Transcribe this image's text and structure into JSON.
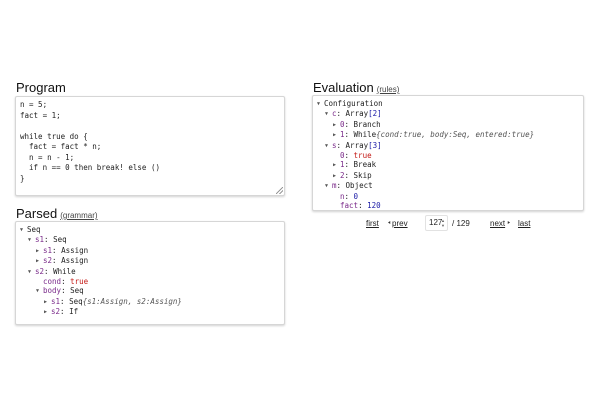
{
  "program": {
    "title": "Program",
    "code": "n = 5;\nfact = 1;\n\nwhile true do {\n  fact = fact * n;\n  n = n - 1;\n  if n == 0 then break! else ()\n}"
  },
  "parsed": {
    "title": "Parsed",
    "grammar_link": "(grammar)",
    "tree": {
      "root": "Seq",
      "s1_key": "s1",
      "s1_type": "Seq",
      "s1_s1_key": "s1",
      "s1_s1_type": "Assign",
      "s1_s2_key": "s2",
      "s1_s2_type": "Assign",
      "s2_key": "s2",
      "s2_type": "While",
      "cond_key": "cond",
      "cond_value": "true",
      "body_key": "body",
      "body_type": "Seq",
      "body_s1_key": "s1",
      "body_s1_type": "Seq",
      "body_s1_note": "{s1:Assign, s2:Assign}",
      "body_s2_key": "s2",
      "body_s2_type": "If"
    }
  },
  "evaluation": {
    "title": "Evaluation",
    "rules_link": "(rules)",
    "tree": {
      "root": "Configuration",
      "c_key": "c",
      "c_type": "Array",
      "c_count": "[2]",
      "c0_key": "0",
      "c0_type": "Branch",
      "c1_key": "1",
      "c1_type": "While",
      "c1_note": "{cond:true, body:Seq, entered:true}",
      "s_key": "s",
      "s_type": "Array",
      "s_count": "[3]",
      "s0_key": "0",
      "s0_value": "true",
      "s1_key": "1",
      "s1_type": "Break",
      "s2_key": "2",
      "s2_type": "Skip",
      "m_key": "m",
      "m_type": "Object",
      "n_key": "n",
      "n_value": "0",
      "fact_key": "fact",
      "fact_value": "120"
    }
  },
  "navigation": {
    "first": "first",
    "prev": "prev",
    "current_step": "127",
    "total": "/ 129",
    "next": "next",
    "last": "last"
  },
  "icons": {
    "expanded": "triangle-down",
    "collapsed": "triangle-right"
  }
}
